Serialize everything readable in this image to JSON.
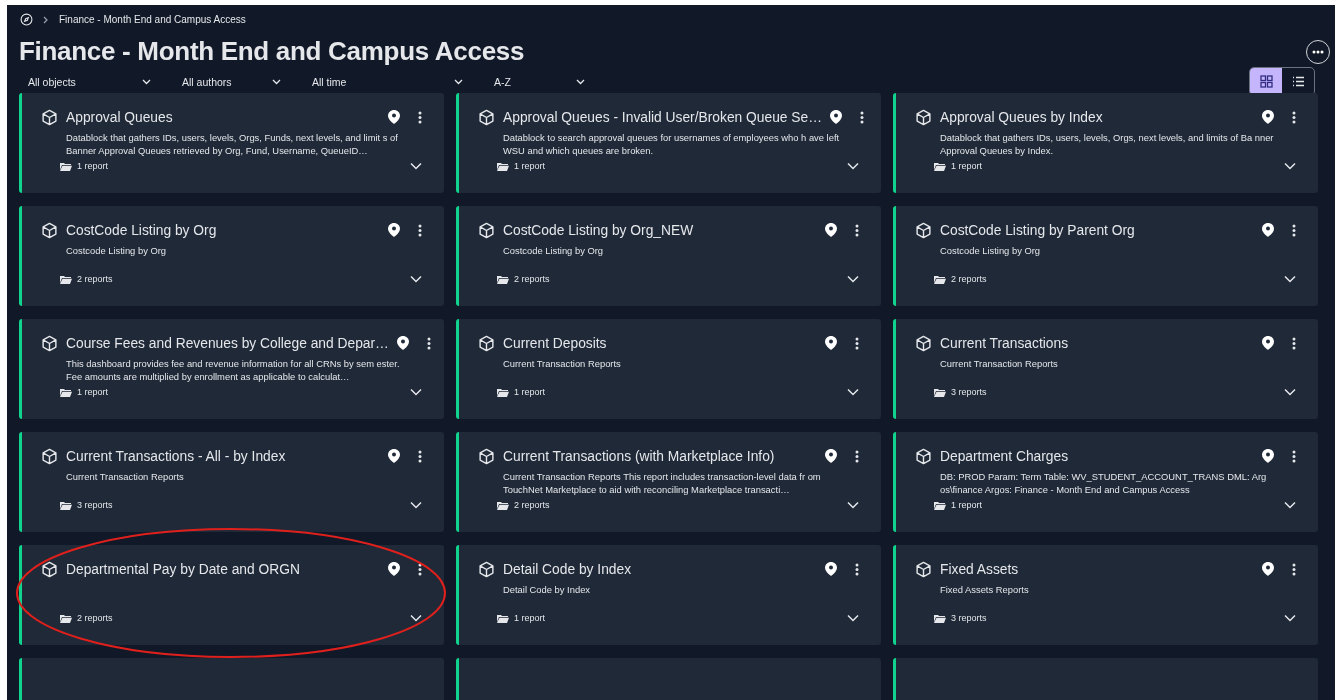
{
  "breadcrumb": {
    "current": "Finance - Month End and Campus Access"
  },
  "title": "Finance - Month End and Campus Access",
  "filters": [
    {
      "label": "All objects"
    },
    {
      "label": "All authors"
    },
    {
      "label": "All time"
    },
    {
      "label": "A-Z"
    }
  ],
  "view_toggle": [
    {
      "kind": "grid",
      "selected": true
    },
    {
      "kind": "list",
      "selected": false
    }
  ],
  "cards": [
    {
      "kind": "card",
      "title": "Approval Queues",
      "description": "Datablock that gathers IDs, users, levels, Orgs, Funds, next levels, and limit s of Banner Approval Queues retrieved by Org, Fund, Username, QueueID…",
      "reports": "1 report",
      "circled": false
    },
    {
      "kind": "card",
      "title": "Approval Queues - Invalid User/Broken Queue Se…",
      "description": "Datablock to search approval queues for usernames of employees who h ave left WSU and which queues are broken.",
      "reports": "1 report",
      "circled": false
    },
    {
      "kind": "card",
      "title": "Approval Queues by Index",
      "description": "Datablock that gathers IDs, users, levels, Orgs, next levels, and limits of Ba nner Approval Queues by Index.",
      "reports": "1 report",
      "circled": false
    },
    {
      "kind": "card",
      "title": "CostCode Listing by Org",
      "description": "Costcode Listing by Org",
      "reports": "2 reports",
      "circled": false
    },
    {
      "kind": "card",
      "title": "CostCode Listing by Org_NEW",
      "description": "Costcode Listing by Org",
      "reports": "2 reports",
      "circled": false
    },
    {
      "kind": "card",
      "title": "CostCode Listing by Parent Org",
      "description": "Costcode Listing by Org",
      "reports": "2 reports",
      "circled": false
    },
    {
      "kind": "card",
      "title": "Course Fees and Revenues by College and Depar…",
      "description": "This dashboard provides fee and revenue information for all CRNs by sem ester. Fee amounts are multiplied by enrollment as applicable to calculat…",
      "reports": "1 report",
      "circled": false
    },
    {
      "kind": "card",
      "title": "Current Deposits",
      "description": "Current Transaction Reports",
      "reports": "1 report",
      "circled": false
    },
    {
      "kind": "card",
      "title": "Current Transactions",
      "description": "Current Transaction Reports",
      "reports": "3 reports",
      "circled": false
    },
    {
      "kind": "card",
      "title": "Current Transactions - All - by Index",
      "description": "Current Transaction Reports",
      "reports": "3 reports",
      "circled": false
    },
    {
      "kind": "card",
      "title": "Current Transactions (with Marketplace Info)",
      "description": "Current Transaction Reports This report includes transaction-level data fr om TouchNet Marketplace to aid with reconciling Marketplace transacti…",
      "reports": "2 reports",
      "circled": false
    },
    {
      "kind": "card",
      "title": "Department Charges",
      "description": "DB: PROD Param: Term Table: WV_STUDENT_ACCOUNT_TRANS DML: Arg os\\finance Argos: Finance - Month End and Campus Access",
      "reports": "1 report",
      "circled": false
    },
    {
      "kind": "card",
      "title": "Departmental Pay by Date and ORGN",
      "reports": "2 reports",
      "circled": true
    },
    {
      "kind": "card",
      "title": "Detail Code by Index",
      "description": "Detail Code by Index",
      "reports": "1 report",
      "circled": false
    },
    {
      "kind": "card",
      "title": "Fixed Assets",
      "description": "Fixed Assets Reports",
      "reports": "3 reports",
      "circled": false
    },
    {
      "kind": "cut"
    },
    {
      "kind": "cut"
    },
    {
      "kind": "cut"
    }
  ]
}
